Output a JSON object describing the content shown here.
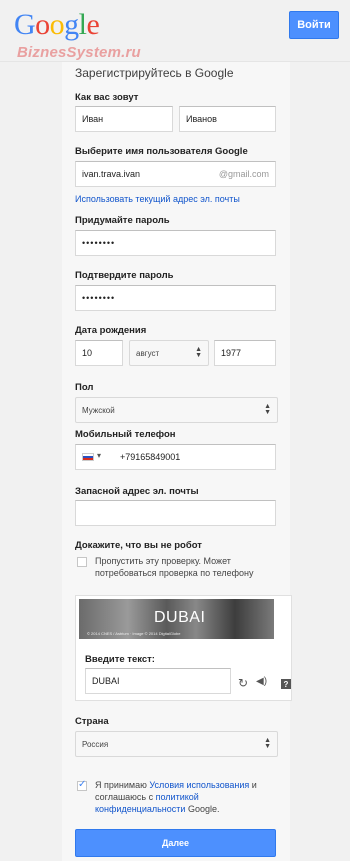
{
  "header": {
    "logo_letters": [
      "G",
      "o",
      "o",
      "g",
      "l",
      "e"
    ],
    "watermark": "BiznesSystem.ru",
    "signin_label": "Войти"
  },
  "form": {
    "title": "Зарегистрируйтесь в Google",
    "name_label": "Как вас зовут",
    "first_name": "Иван",
    "last_name": "Иванов",
    "username_label": "Выберите имя пользователя Google",
    "username_value": "ivan.trava.ivan",
    "username_suffix": "@gmail.com",
    "use_current_email_link": "Использовать текущий адрес эл. почты",
    "password_label": "Придумайте пароль",
    "password_value": "••••••••",
    "confirm_label": "Подтвердите пароль",
    "confirm_value": "••••••••",
    "birth_label": "Дата рождения",
    "birth_day": "10",
    "birth_month": "август",
    "birth_year": "1977",
    "gender_label": "Пол",
    "gender_value": "Мужской",
    "phone_label": "Мобильный телефон",
    "phone_value": "+79165849001",
    "backup_email_label": "Запасной адрес эл. почты",
    "backup_email_value": "",
    "robot_label": "Докажите, что вы не робот",
    "skip_verification_text": "Пропустить эту проверку. Может потребоваться проверка по телефону",
    "captcha_word": "DUBAI",
    "captcha_credit": "© 2014 CNES / Astrium · Image © 2014 DigitalGlobe",
    "captcha_input_label": "Введите текст:",
    "captcha_input_value": "DUBAI",
    "country_label": "Страна",
    "country_value": "Россия",
    "terms_prefix": "Я принимаю ",
    "terms_link": "Условия использования",
    "terms_middle": " и соглашаюсь с ",
    "privacy_link": "политикой конфиденциальности",
    "terms_suffix": " Google.",
    "next_label": "Далее"
  },
  "colors": {
    "accent": "#4d90fe",
    "link": "#1155cc",
    "background": "#f1f1f1"
  }
}
